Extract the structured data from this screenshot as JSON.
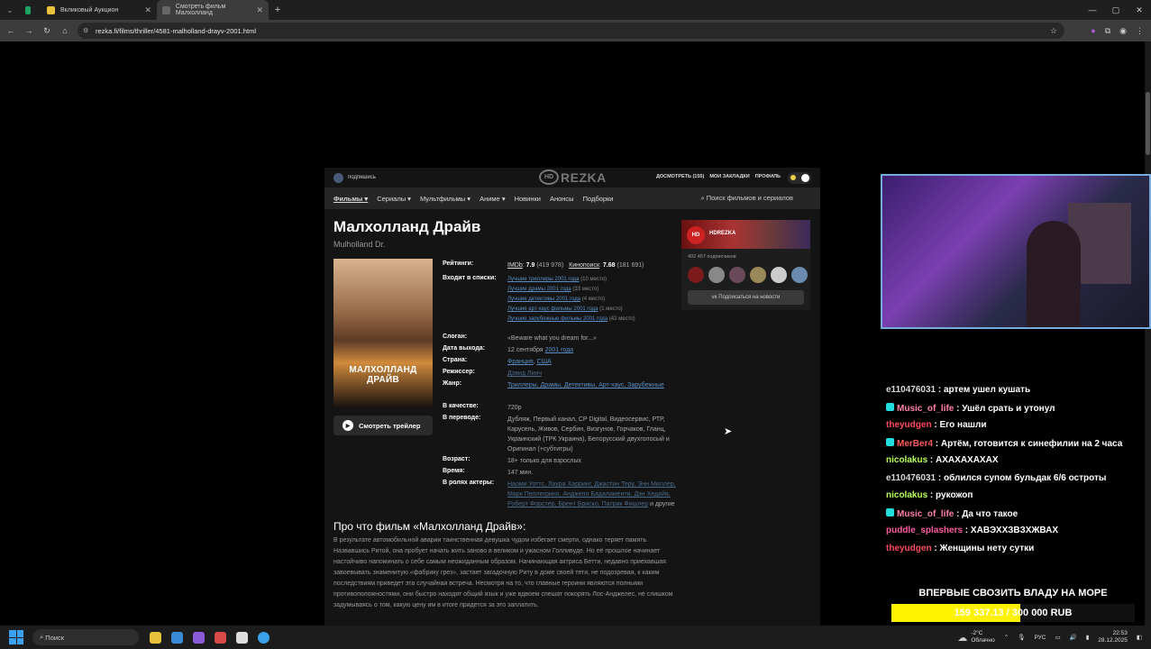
{
  "browser": {
    "tabs": [
      {
        "label": "Вкликовый Аукцион",
        "icon_color": "#e8c23a"
      },
      {
        "label": "Смотреть фильм Малхолланд",
        "icon_color": "#666666"
      }
    ],
    "url": "rezka.fi/films/thriller/4581-malholland-drayv-2001.html"
  },
  "site": {
    "subscribe_label": "подпишись",
    "logo_hd": "HD",
    "logo_text": "REZKA",
    "userlinks": [
      "ДОСМОТРЕТЬ (155)",
      "МОИ ЗАКЛАДКИ",
      "ПРОФИЛЬ"
    ],
    "nav": [
      "Фильмы",
      "Сериалы",
      "Мультфильмы",
      "Аниме",
      "Новинки",
      "Анонсы",
      "Подборки"
    ],
    "search_placeholder": "Поиск фильмов и сериалов"
  },
  "film": {
    "title": "Малхолланд Драйв",
    "original_title": "Mulholland Dr.",
    "poster_title": "МАЛХОЛЛАНД ДРАЙВ",
    "trailer_label": "Смотреть трейлер",
    "labels": {
      "ratings": "Рейтинги:",
      "lists": "Входит в списки:",
      "slogan": "Слоган:",
      "release": "Дата выхода:",
      "country": "Страна:",
      "director": "Режиссер:",
      "genre": "Жанр:",
      "quality": "В качестве:",
      "translation": "В переводе:",
      "age": "Возраст:",
      "time": "Время:",
      "actors": "В ролях актеры:"
    },
    "imdb_label": "IMDb",
    "imdb_rating": "7.9",
    "imdb_votes": "(419 978)",
    "kp_label": "Кинопоиск",
    "kp_rating": "7.68",
    "kp_votes": "(181 691)",
    "lists": [
      {
        "name": "Лучшие триллеры 2001 года",
        "place": "(10 место)"
      },
      {
        "name": "Лучшие драмы 2001 года",
        "place": "(33 место)"
      },
      {
        "name": "Лучшие детективы 2001 года",
        "place": "(4 место)"
      },
      {
        "name": "Лучшие арт-хаус фильмы 2001 года",
        "place": "(1 место)"
      },
      {
        "name": "Лучшие зарубежные фильмы 2001 года",
        "place": "(42 место)"
      }
    ],
    "slogan": "«Beware what you dream for...»",
    "release_date": "12 сентября",
    "release_year": "2001 года",
    "country_1": "Франция",
    "country_2": "США",
    "director": "Дэвид Линч",
    "genres": "Триллеры, Драмы, Детективы, Арт-хаус, Зарубежные",
    "quality": "720p",
    "translation": "Дубляж, Первый канал, CP Digital, Видеосервис, РТР, Карусель, Живов, Сербин, Визгунов, Горчаков, Гланц, Украинский (ТРК Украина), Белорусский двухголосый и Оригинал (+субтитры)",
    "age": "18+ только для взрослых",
    "time": "147 мин.",
    "actors": "Наоми Уоттс, Лаура Харринг, Джастин Теру, Энн Миллер, Марк Пеллегрино, Анджело Бадаламенти, Дэн Хедайя, Роберт Форстер, Брент Бриско, Патрик Фишлер",
    "actors_suffix": "и другие",
    "about_heading": "Про что фильм «Малхолланд Драйв»:",
    "about_text": "В результате автомобильной аварии таинственная девушка чудом избегает смерти, однако теряет память. Назвавшись Ритой, она пробует начать жить заново в великом и ужасном Голливуде. Но её прошлое начинает настойчиво напоминать о себе самым неожиданным образом. Начинающая актриса Бетти, недавно приехавшая завоевывать знаменитую «фабрику грез», застает загадочную Риту в доме своей тети, не подозревая, к каким последствиям приведет эта случайная встреча. Несмотря на то, что главные героини являются полными противоположностями, они быстро находят общий язык и уже вдвоем спешат покорять Лос-Анджелес, не слишком задумываясь о том, какую цену им в итоге придется за это заплатить."
  },
  "sidebox": {
    "logo": "HD REZKA",
    "name": "HDREZKA",
    "subscribers": "402 457 подписчиков",
    "vk_button": "Подписаться на новости"
  },
  "chat": [
    {
      "user": "e110476031",
      "text": "артем ушел кушать",
      "color": "#d8d8d8",
      "badge": false
    },
    {
      "user": "Music_of_life",
      "text": "Ушёл срать и утонул",
      "color": "#ff7fa8",
      "badge": true
    },
    {
      "user": "theyudgen",
      "text": "Его нашли",
      "color": "#ff4a5a",
      "badge": false
    },
    {
      "user": "MerBer4",
      "text": "Артём, готовится к синефилии на 2 часа",
      "color": "#ff5a5a",
      "badge": true
    },
    {
      "user": "nicolakus",
      "text": "АХАХАХАХАХ",
      "color": "#b8ff5a",
      "badge": false
    },
    {
      "user": "e110476031",
      "text": "облился супом бульдак 6/6 остроты",
      "color": "#d8d8d8",
      "badge": false
    },
    {
      "user": "nicolakus",
      "text": "рукожоп",
      "color": "#b8ff5a",
      "badge": false
    },
    {
      "user": "Music_of_life",
      "text": "Да что такое",
      "color": "#ff7fa8",
      "badge": true
    },
    {
      "user": "puddle_splashers",
      "text": "ХАВЭХХЗВЗХЖВАХ",
      "color": "#ff5aa0",
      "badge": false
    },
    {
      "user": "theyudgen",
      "text": "Женщины нету сутки",
      "color": "#ff4a5a",
      "badge": false
    }
  ],
  "donation": {
    "title": "ВПЕРВЫЕ СВОЗИТЬ ВЛАДУ НА МОРЕ",
    "amount_text": "159 337.13 / 300 000 RUB",
    "progress": 0.531
  },
  "taskbar": {
    "search": "Поиск",
    "temp": "-2°C",
    "weather": "Облачно",
    "lang": "РУС",
    "time": "22:53",
    "date": "28.12.2025"
  }
}
